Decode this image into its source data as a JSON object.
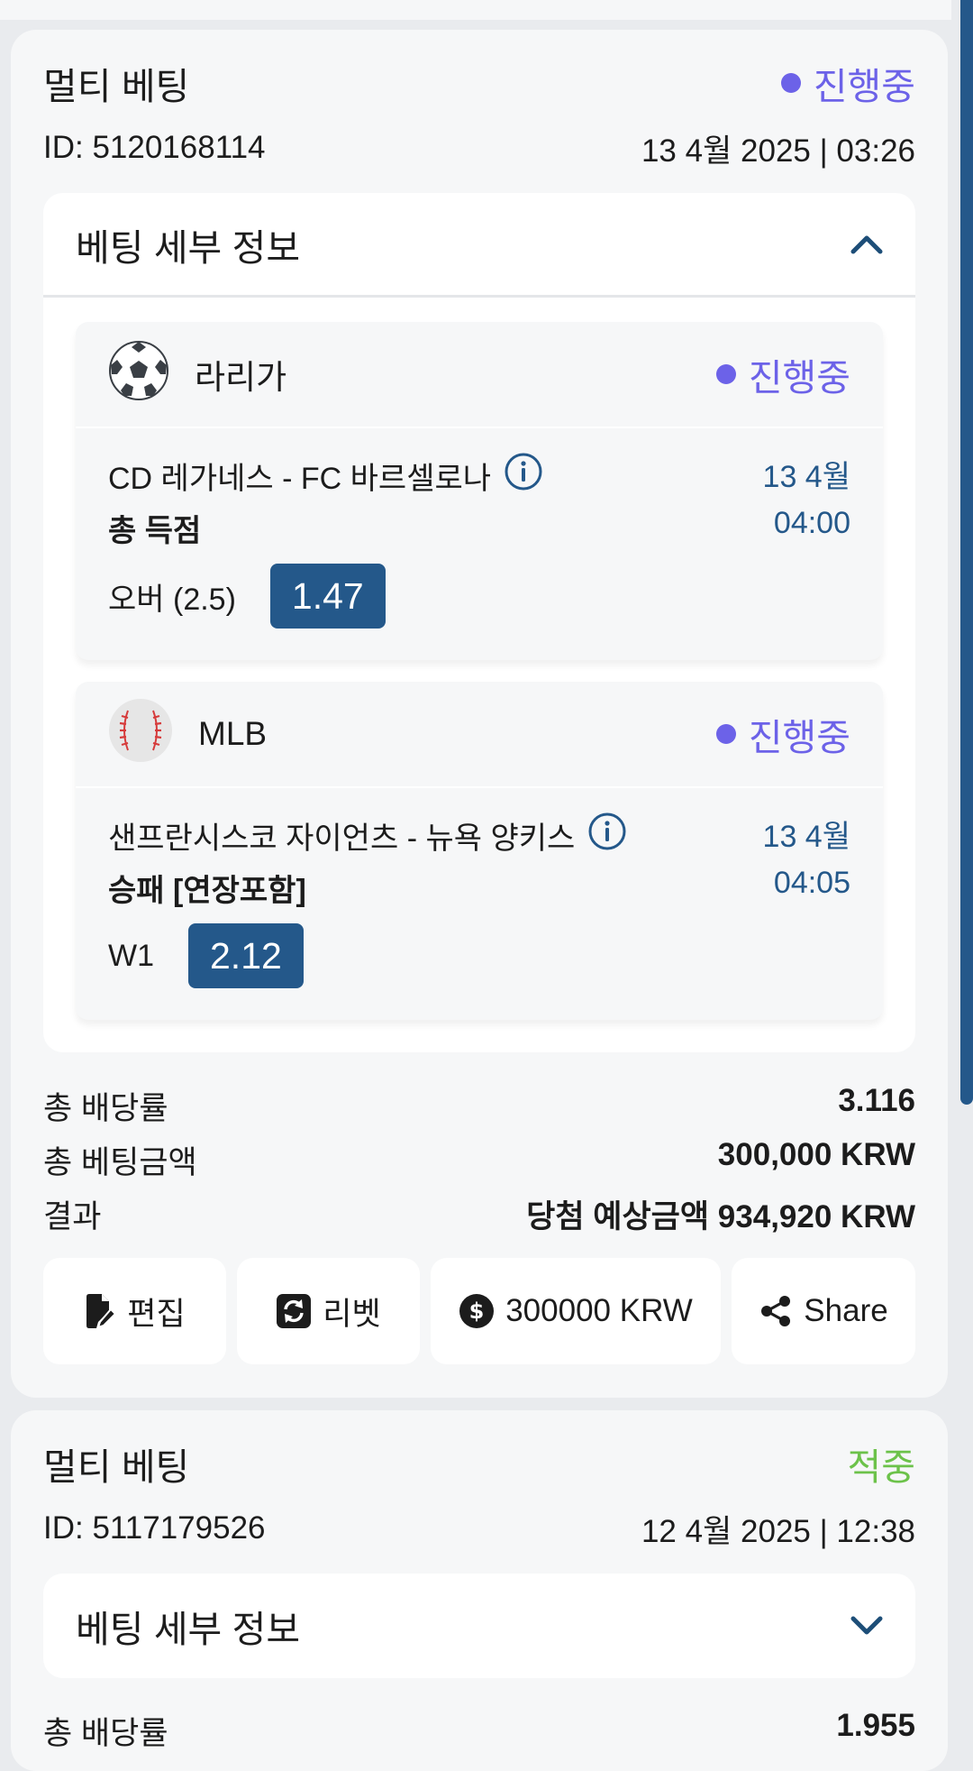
{
  "bets": [
    {
      "type": "멀티 베팅",
      "status": "진행중",
      "id": "ID: 5120168114",
      "datetime": "13 4월 2025 | 03:26",
      "details_title": "베팅 세부 정보",
      "legs": [
        {
          "sport_icon": "soccer-ball-icon",
          "league": "라리가",
          "status": "진행중",
          "match": "CD 레가네스 - FC 바르셀로나",
          "market": "총 득점",
          "date": "13 4월",
          "time": "04:00",
          "selection": "오버 (2.5)",
          "odds": "1.47"
        },
        {
          "sport_icon": "baseball-icon",
          "league": "MLB",
          "status": "진행중",
          "match": "샌프란시스코 자이언츠 - 뉴욕 양키스",
          "market": "승패 [연장포함]",
          "date": "13 4월",
          "time": "04:05",
          "selection": "W1",
          "odds": "2.12"
        }
      ],
      "summary": {
        "total_odds_label": "총 배당률",
        "total_odds_value": "3.116",
        "stake_label": "총 베팅금액",
        "stake_value": "300,000 KRW",
        "result_label": "결과",
        "result_value": "당첨 예상금액 934,920 KRW"
      },
      "actions": {
        "edit": "편집",
        "rebet": "리벳",
        "cashout": "300000 KRW",
        "share": "Share"
      }
    },
    {
      "type": "멀티 베팅",
      "status": "적중",
      "id": "ID: 5117179526",
      "datetime": "12 4월 2025 | 12:38",
      "details_title": "베팅 세부 정보",
      "summary_partial_label": "총 배당률",
      "summary_partial_value": "1.955"
    }
  ],
  "colors": {
    "accent": "#24588a",
    "status_live": "#6c62e8",
    "status_won": "#6cc24a",
    "card_bg": "#f6f7f8"
  }
}
